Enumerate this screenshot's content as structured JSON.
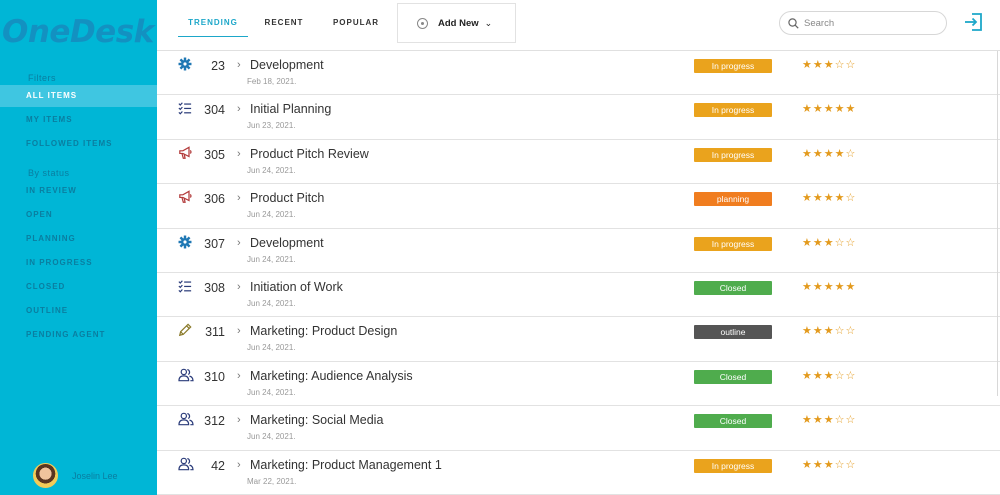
{
  "app": {
    "logo": "OneDesk"
  },
  "sidebar": {
    "filters_label": "Filters",
    "filters": [
      {
        "label": "ALL ITEMS",
        "active": true
      },
      {
        "label": "MY ITEMS",
        "active": false
      },
      {
        "label": "FOLLOWED ITEMS",
        "active": false
      }
    ],
    "status_label": "By status",
    "statuses": [
      {
        "label": "IN REVIEW"
      },
      {
        "label": "OPEN"
      },
      {
        "label": "PLANNING"
      },
      {
        "label": "IN PROGRESS"
      },
      {
        "label": "CLOSED"
      },
      {
        "label": "OUTLINE"
      },
      {
        "label": "PENDING AGENT"
      }
    ],
    "user": {
      "name": "Joselin Lee"
    }
  },
  "header": {
    "tabs": [
      {
        "label": "TRENDING",
        "active": true
      },
      {
        "label": "RECENT",
        "active": false
      },
      {
        "label": "POPULAR",
        "active": false
      }
    ],
    "add_new": "Add New",
    "search_placeholder": "Search"
  },
  "colors": {
    "sidebar_bg": "#00b6d6",
    "active_item_bg": "#3fc6e1",
    "in_progress": "#eaa31d",
    "planning": "#f07d1f",
    "closed": "#4fac4d",
    "outline": "#555555",
    "star": "#e39a1d"
  },
  "items": [
    {
      "icon": "gear-icon",
      "id": "23",
      "title": "Development",
      "date": "Feb 18, 2021.",
      "status": "In progress",
      "status_color": "#eaa31d",
      "rating": 3
    },
    {
      "icon": "checklist-icon",
      "id": "304",
      "title": "Initial Planning",
      "date": "Jun 23, 2021.",
      "status": "In progress",
      "status_color": "#eaa31d",
      "rating": 5
    },
    {
      "icon": "megaphone-icon",
      "id": "305",
      "title": "Product Pitch Review",
      "date": "Jun 24, 2021.",
      "status": "In progress",
      "status_color": "#eaa31d",
      "rating": 4
    },
    {
      "icon": "megaphone-icon",
      "id": "306",
      "title": "Product Pitch",
      "date": "Jun 24, 2021.",
      "status": "planning",
      "status_color": "#f07d1f",
      "rating": 4
    },
    {
      "icon": "gear-icon",
      "id": "307",
      "title": "Development",
      "date": "Jun 24, 2021.",
      "status": "In progress",
      "status_color": "#eaa31d",
      "rating": 3
    },
    {
      "icon": "checklist-icon",
      "id": "308",
      "title": "Initiation of Work",
      "date": "Jun 24, 2021.",
      "status": "Closed",
      "status_color": "#4fac4d",
      "rating": 5
    },
    {
      "icon": "pencil-icon",
      "id": "311",
      "title": "Marketing: Product Design",
      "date": "Jun 24, 2021.",
      "status": "outline",
      "status_color": "#555555",
      "rating": 3
    },
    {
      "icon": "users-icon",
      "id": "310",
      "title": "Marketing: Audience Analysis",
      "date": "Jun 24, 2021.",
      "status": "Closed",
      "status_color": "#4fac4d",
      "rating": 3
    },
    {
      "icon": "users-icon",
      "id": "312",
      "title": "Marketing: Social Media",
      "date": "Jun 24, 2021.",
      "status": "Closed",
      "status_color": "#4fac4d",
      "rating": 3
    },
    {
      "icon": "users-icon",
      "id": "42",
      "title": "Marketing: Product Management 1",
      "date": "Mar 22, 2021.",
      "status": "In progress",
      "status_color": "#eaa31d",
      "rating": 3
    }
  ]
}
